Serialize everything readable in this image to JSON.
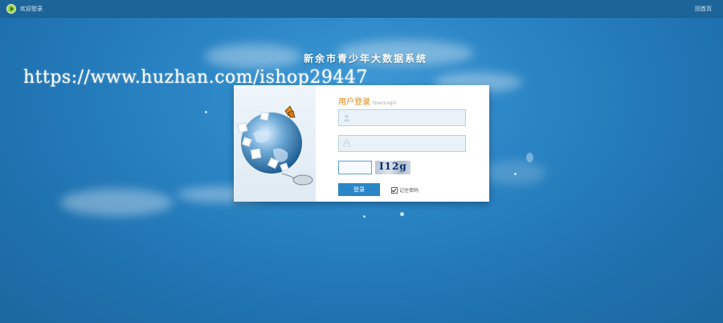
{
  "topbar": {
    "welcome": "欢迎登录",
    "home_link": "回首页"
  },
  "system_title": "新余市青少年大数据系统",
  "watermark": "https://www.huzhan.com/ishop29447",
  "login": {
    "title": "用户登录",
    "subtitle": "UserLogin",
    "username": {
      "value": "",
      "placeholder": ""
    },
    "password": {
      "value": "",
      "placeholder": ""
    },
    "captcha": {
      "value": "",
      "code_text": "I12g"
    },
    "login_button": "登录",
    "remember_label": "记住密码",
    "remember_checked": true
  },
  "icons": {
    "topbar": "play-circle-icon",
    "username": "user-icon",
    "password": "lock-icon"
  },
  "colors": {
    "background": "#2a84c4",
    "topbar": "#1d6599",
    "button": "#2b86c8",
    "login_title": "#e08a1a"
  }
}
